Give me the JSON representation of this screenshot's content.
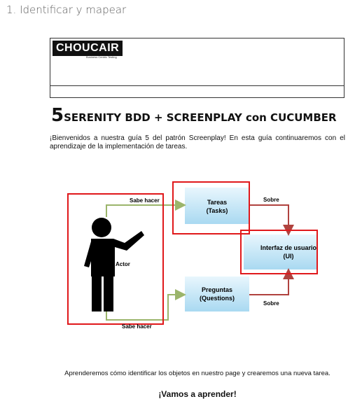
{
  "section_heading": "1. Identificar y mapear",
  "logo": {
    "brand": "CHOUCAIR",
    "tagline": "Business Centric Testing"
  },
  "guide": {
    "number": "5",
    "title": "SERENITY BDD + SCREENPLAY con CUCUMBER",
    "intro": "¡Bienvenidos a nuestra guía 5 del patrón Screenplay! En esta guía continuaremos con el aprendizaje de la implementación de tareas.",
    "outro": "Aprenderemos cómo identificar los objetos en nuestro page y crearemos una nueva tarea.",
    "cta": "¡Vamos a aprender!"
  },
  "diagram": {
    "actor_label": "Actor",
    "sabe_hacer_top": "Sabe hacer",
    "sabe_hacer_bottom": "Sabe hacer",
    "sobre_top": "Sobre",
    "sobre_bottom": "Sobre",
    "tasks_line1": "Tareas",
    "tasks_line2": "(Tasks)",
    "questions_line1": "Preguntas",
    "questions_line2": "(Questions)",
    "ui_line1": "Interfaz de usuario",
    "ui_line2": "(UI)",
    "colors": {
      "highlight": "#e0181b",
      "arrow_green": "#9bb56b",
      "arrow_red": "#b0423e",
      "box_fill": "#bfe3f5"
    }
  }
}
